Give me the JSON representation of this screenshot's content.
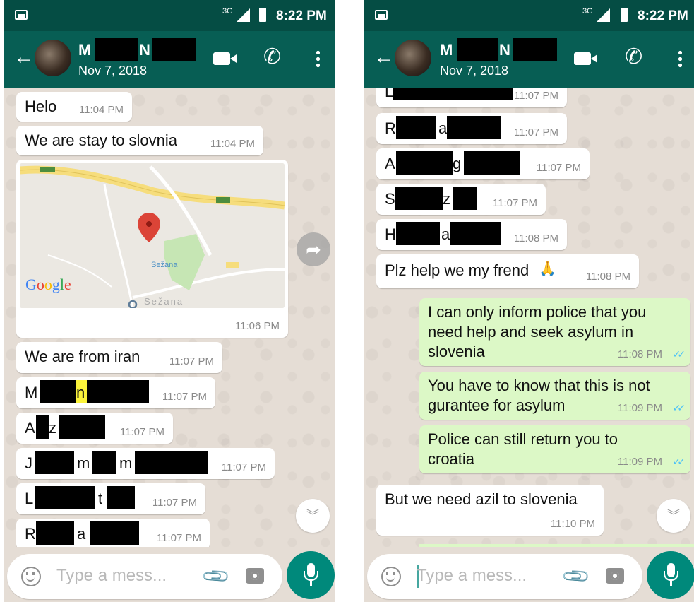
{
  "status_bar": {
    "network": "3G",
    "time": "8:22 PM"
  },
  "contact": {
    "name_initial": "M",
    "name_letter2": "N",
    "last_seen": "Nov 7, 2018"
  },
  "input": {
    "placeholder": "Type a mess..."
  },
  "icons": {
    "back": "arrow-left-icon",
    "video": "video-call-icon",
    "call": "phone-icon",
    "more": "more-vert-icon",
    "emoji": "emoji-icon",
    "attach": "paperclip-icon",
    "camera": "camera-icon",
    "mic": "microphone-icon",
    "forward": "forward-icon",
    "scroll_down": "double-chevron-down-icon"
  },
  "colors": {
    "header": "#075e54",
    "status": "#054d44",
    "incoming": "#ffffff",
    "outgoing": "#dcf8c6",
    "chat_bg": "#e5ddd5",
    "read_ticks": "#4fc3f7",
    "fab": "#00897b"
  },
  "left_chat": {
    "messages": [
      {
        "text": "Helo",
        "time": "11:04 PM"
      },
      {
        "text": "We are stay to slovnia",
        "time": "11:04 PM"
      },
      {
        "type": "location",
        "time": "11:06 PM",
        "map": {
          "logo": "Google",
          "place1": "Sežana",
          "place2": "Sežana"
        }
      },
      {
        "text": "We are from iran",
        "time": "11:07 PM"
      },
      {
        "time": "11:07 PM",
        "letters": [
          "M",
          "n"
        ]
      },
      {
        "time": "11:07 PM",
        "letters": [
          "A",
          "z"
        ]
      },
      {
        "time": "11:07 PM",
        "letters": [
          "J",
          "m",
          "m"
        ]
      },
      {
        "time": "11:07 PM",
        "letters": [
          "L",
          "t"
        ]
      },
      {
        "time": "11:07 PM",
        "letters": [
          "R",
          "a"
        ]
      }
    ]
  },
  "right_chat": {
    "messages": [
      {
        "time": "11:07 PM",
        "letters": [
          "L"
        ]
      },
      {
        "time": "11:07 PM",
        "letters": [
          "R",
          "a"
        ]
      },
      {
        "time": "11:07 PM",
        "letters": [
          "A",
          "g"
        ]
      },
      {
        "time": "11:07 PM",
        "letters": [
          "S",
          "z"
        ]
      },
      {
        "time": "11:08 PM",
        "letters": [
          "H",
          "a"
        ]
      },
      {
        "text": "Plz help we my frend",
        "emoji": "🙏",
        "time": "11:08 PM"
      },
      {
        "text": "I can only inform police that you\nneed help and seek asylum in\nslovenia",
        "time": "11:08 PM",
        "outgoing": true,
        "ticks": "✓✓"
      },
      {
        "text": "You have to know that this is not\ngurantee for asylum",
        "time": "11:09 PM",
        "outgoing": true,
        "ticks": "✓✓"
      },
      {
        "text": "Police can still return you to\ncroatia",
        "time": "11:09 PM",
        "outgoing": true,
        "ticks": "✓✓"
      },
      {
        "text": "But we need azil to slovenia",
        "time": "11:10 PM"
      }
    ]
  }
}
